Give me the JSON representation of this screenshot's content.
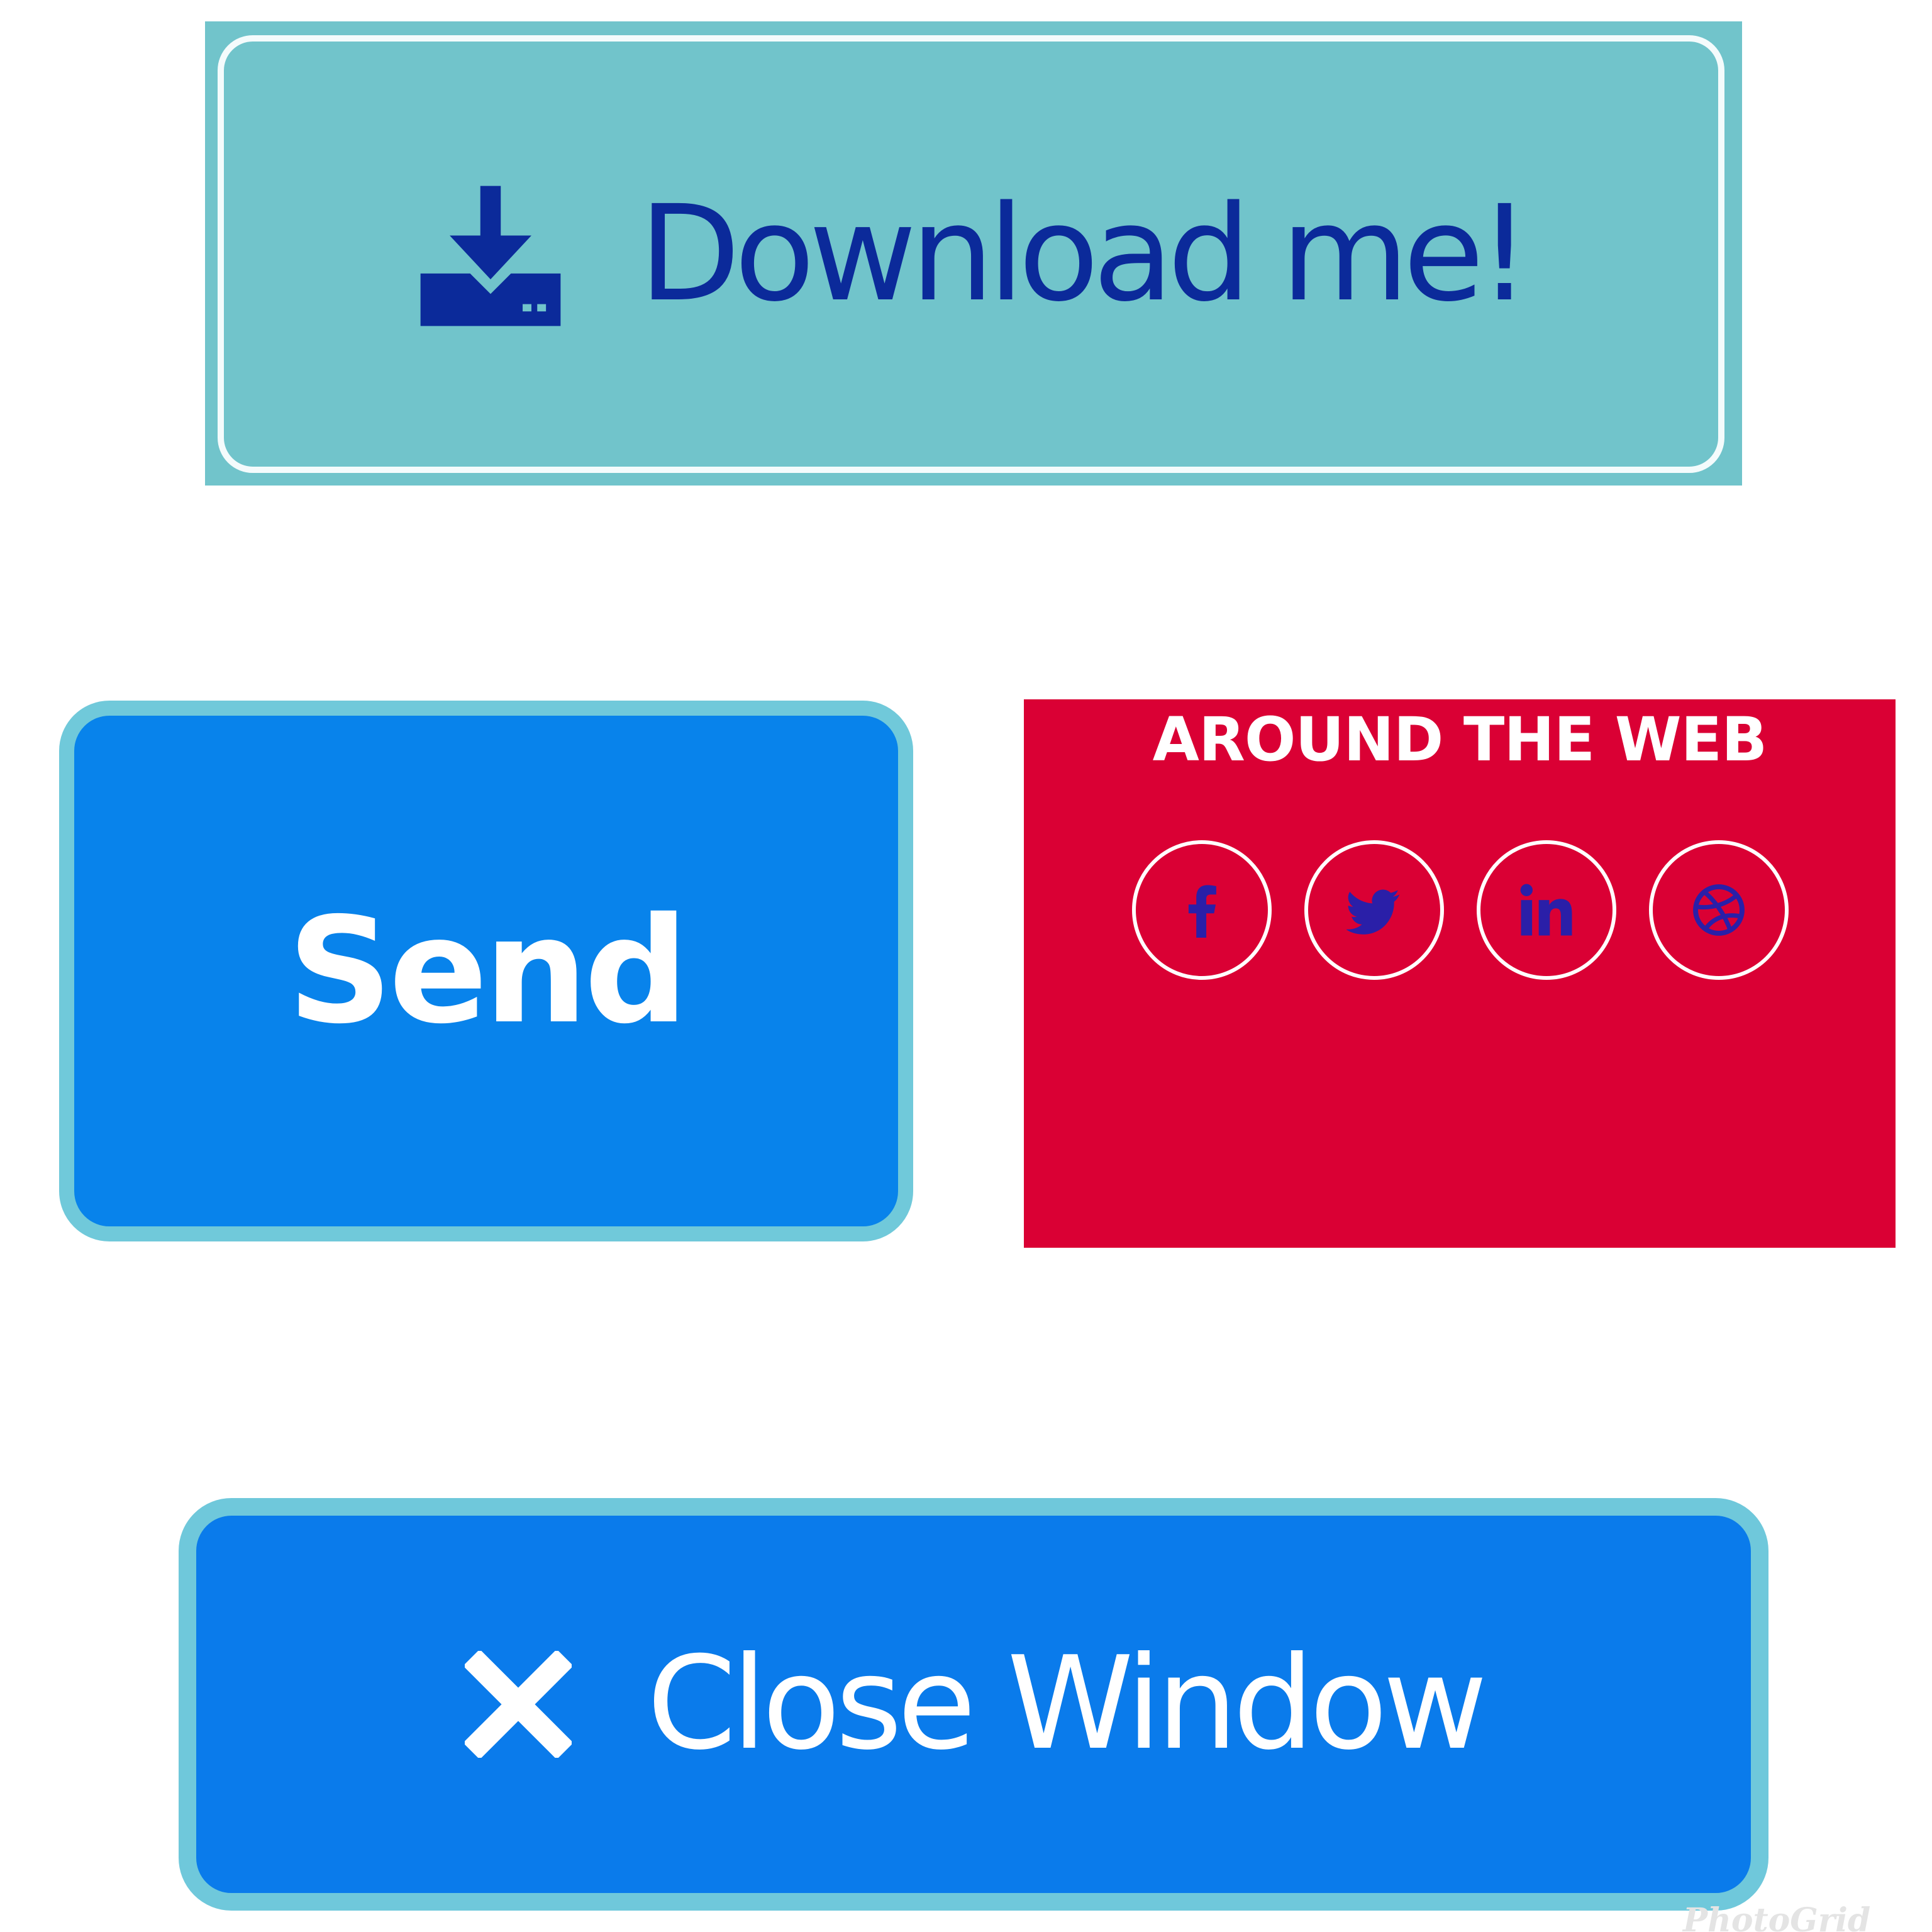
{
  "download": {
    "label": "Download me!",
    "icon": "download-icon",
    "colors": {
      "background": "#71c4cb",
      "text": "#0b2a9a"
    }
  },
  "send": {
    "label": "Send",
    "colors": {
      "background": "#0883eb",
      "border": "#70c9da",
      "text": "#ffffff"
    }
  },
  "around_web": {
    "title": "AROUND THE WEB",
    "links": [
      {
        "name": "facebook",
        "icon": "facebook-icon"
      },
      {
        "name": "twitter",
        "icon": "twitter-icon"
      },
      {
        "name": "linkedin",
        "icon": "linkedin-icon"
      },
      {
        "name": "dribbble",
        "icon": "dribbble-icon"
      }
    ],
    "colors": {
      "background": "#da0034",
      "icon": "#2a1fa8",
      "ring": "#ffffff"
    }
  },
  "close": {
    "label": "Close Window",
    "icon": "close-icon",
    "colors": {
      "background": "#0a7beb",
      "border": "#6fc8db",
      "text": "#ffffff"
    }
  },
  "watermark": "PhotoGrid"
}
